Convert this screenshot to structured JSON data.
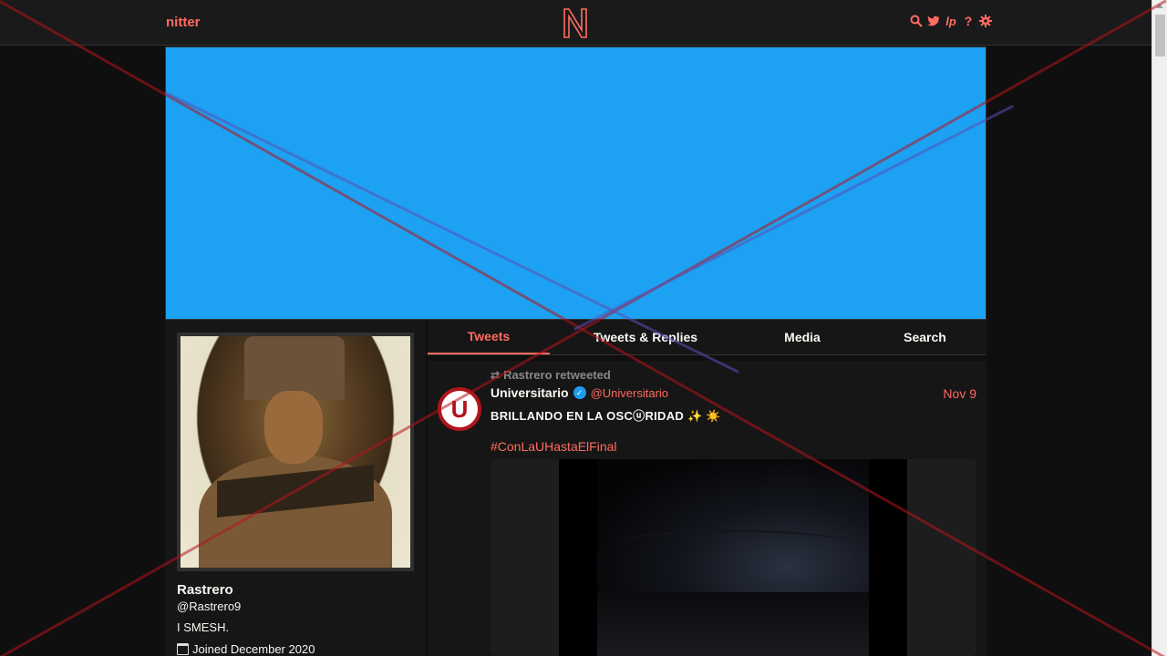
{
  "navbar": {
    "brand": "nitter",
    "logo_letter": "N",
    "icons": [
      "search-icon",
      "twitter-bird-icon",
      "lp-icon",
      "help-icon",
      "gear-icon"
    ],
    "icon_glyphs": {
      "lp": "lp",
      "help": "?"
    }
  },
  "profile": {
    "name": "Rastrero",
    "handle": "@Rastrero9",
    "bio": "I SMESH.",
    "joined": "Joined December 2020"
  },
  "tabs": [
    {
      "label": "Tweets",
      "active": true
    },
    {
      "label": "Tweets & Replies",
      "active": false
    },
    {
      "label": "Media",
      "active": false
    },
    {
      "label": "Search",
      "active": false
    }
  ],
  "tweet": {
    "retweet_label": "Rastrero retweeted",
    "fullname": "Universitario",
    "handle": "@Universitario",
    "date": "Nov 9",
    "text": "BRILLANDO EN LA OSCⓤRIDAD ✨ ☀️",
    "hashtag": "#ConLaUHastaElFinal",
    "avatar_letter": "U"
  },
  "colors": {
    "accent": "#ff6c60",
    "banner": "#1da1f2",
    "background": "#0f0f0f",
    "panel": "#161616"
  }
}
